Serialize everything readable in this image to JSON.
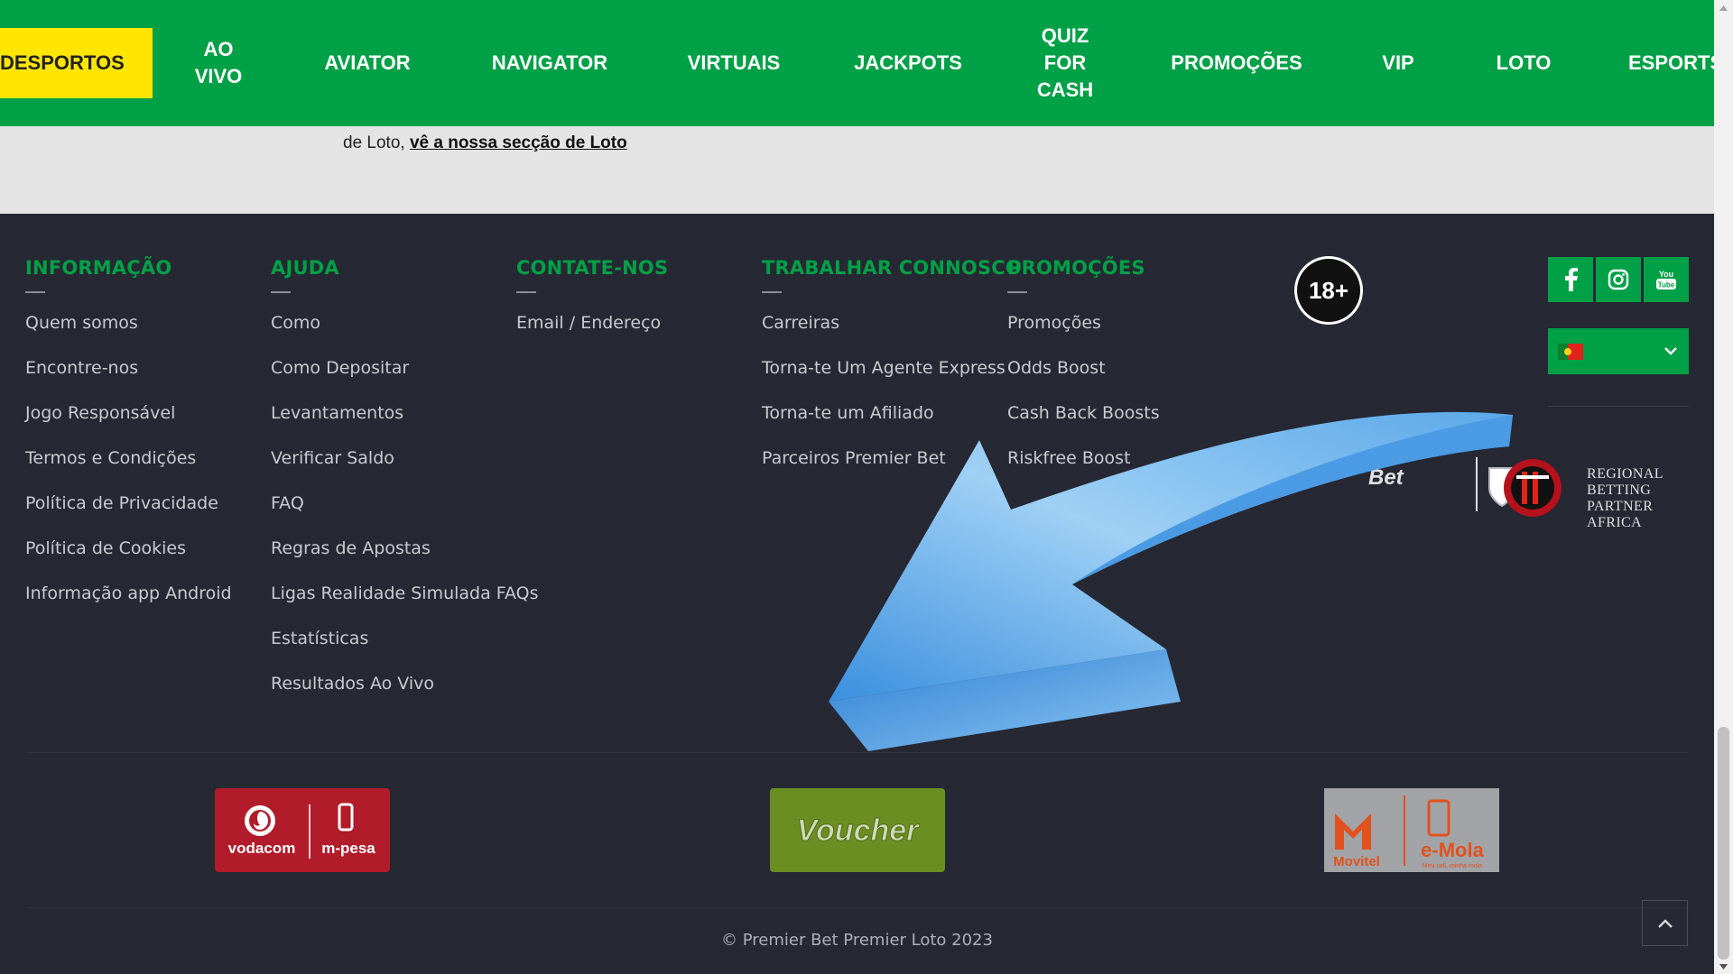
{
  "nav": {
    "items": [
      "DESPORTOS",
      "AO\nVIVO",
      "AVIATOR",
      "NAVIGATOR",
      "VIRTUAIS",
      "JACKPOTS",
      "QUIZ\nFOR\nCASH",
      "PROMOÇÕES",
      "VIP",
      "LOTO",
      "ESPORTS"
    ],
    "active": "DESPORTOS"
  },
  "content": {
    "text_prefix": "de Loto, ",
    "link": "vê a nossa secção de Loto"
  },
  "footer": {
    "columns": [
      {
        "title": "INFORMAÇÃO",
        "items": [
          "Quem somos",
          "Encontre-nos",
          "Jogo Responsável",
          "Termos e Condições",
          "Política de Privacidade",
          "Política de Cookies",
          "Informação app Android"
        ]
      },
      {
        "title": "AJUDA",
        "items": [
          "Como",
          "Como Depositar",
          "Levantamentos",
          "Verificar Saldo",
          "FAQ",
          "Regras de Apostas",
          "Ligas Realidade Simulada FAQs",
          "Estatísticas",
          "Resultados Ao Vivo"
        ]
      },
      {
        "title": "CONTATE-NOS",
        "items": [
          "Email / Endereço"
        ]
      },
      {
        "title": "TRABALHAR CONNOSCO",
        "items": [
          "Carreiras",
          "Torna-te Um Agente Express",
          "Torna-te um Afiliado",
          "Parceiros Premier Bet"
        ]
      },
      {
        "title": "PROMOÇÕES",
        "items": [
          "Promoções",
          "Odds Boost",
          "Cash Back Boosts",
          "Riskfree Boost"
        ]
      }
    ],
    "age_badge": "18+",
    "social": [
      "facebook-icon",
      "instagram-icon",
      "youtube-icon"
    ],
    "language_flag": "portugal-flag",
    "partner": {
      "brand": "Bet",
      "line1": "REGIONAL",
      "line2": "BETTING PARTNER",
      "line3": "AFRICA"
    },
    "payments": {
      "vodacom": "vodacom",
      "mpesa": "m-pesa",
      "voucher": "Voucher",
      "movitel": "Movitel",
      "emola": "e-Mola",
      "emola_sub": "Meu cell, minha mola"
    },
    "copyright": "© Premier Bet Premier Loto 2023"
  },
  "colors": {
    "brand_green": "#00a046",
    "active_yellow": "#ffe500",
    "footer_bg": "#262833",
    "arrow_blue": "#5aa8e8"
  }
}
